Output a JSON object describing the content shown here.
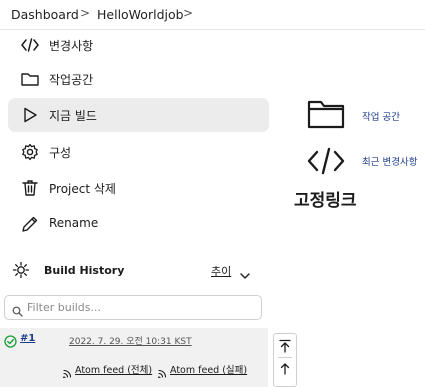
{
  "breadcrumb": {
    "items": [
      "Dashboard",
      "HelloWorldjob"
    ],
    "separator": ">"
  },
  "sidebar": {
    "tasks": [
      {
        "label": "변경사항",
        "icon": "code-icon"
      },
      {
        "label": "작업공간",
        "icon": "folder-icon"
      },
      {
        "label": "지금 빌드",
        "icon": "play-icon",
        "active": true
      },
      {
        "label": "구성",
        "icon": "gear-icon"
      },
      {
        "label": "Project 삭제",
        "icon": "trash-icon"
      },
      {
        "label": "Rename",
        "icon": "pencil-icon"
      }
    ]
  },
  "build_history": {
    "title": "Build History",
    "trend_label": "추이",
    "filter_placeholder": "Filter builds...",
    "builds": [
      {
        "number": "#1",
        "date": "2022. 7. 29. 오전 10:31 KST",
        "status": "success"
      }
    ],
    "feeds": [
      {
        "label": "Atom feed (전체)"
      },
      {
        "label": "Atom feed (실패)"
      }
    ]
  },
  "main": {
    "links": [
      {
        "label": "작업 공간",
        "icon": "folder-icon"
      },
      {
        "label": "최근 변경사항",
        "icon": "code-icon"
      }
    ],
    "permalinks_title": "고정링크"
  },
  "colors": {
    "link": "#1f3c8c",
    "active_bg": "#ececed",
    "success": "#1a9e3a"
  }
}
